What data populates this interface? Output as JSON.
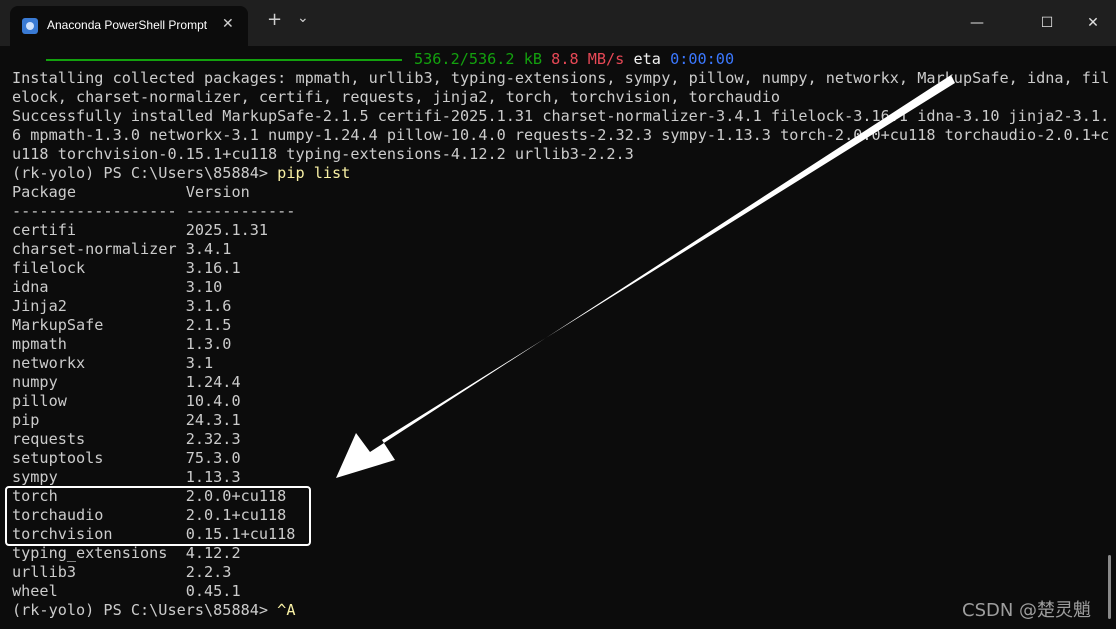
{
  "window": {
    "tab_title": "Anaconda PowerShell Prompt",
    "tab_close": "✕",
    "new_tab": "+",
    "dropdown": "⌄",
    "minimize": "—",
    "maximize": "☐",
    "close": "✕"
  },
  "progress": {
    "size": "536.2/536.2 kB",
    "speed": "8.8 MB/s",
    "eta_label": "eta",
    "eta_value": "0:00:00"
  },
  "output": {
    "installing_1": "Installing collected packages: mpmath, urllib3, typing-extensions, sympy, pillow, numpy, networkx, MarkupSafe, idna, fil",
    "installing_2": "elock, charset-normalizer, certifi, requests, jinja2, torch, torchvision, torchaudio",
    "success_1": "Successfully installed MarkupSafe-2.1.5 certifi-2025.1.31 charset-normalizer-3.4.1 filelock-3.16.1 idna-3.10 jinja2-3.1.",
    "success_2": "6 mpmath-1.3.0 networkx-3.1 numpy-1.24.4 pillow-10.4.0 requests-2.32.3 sympy-1.13.3 torch-2.0.0+cu118 torchaudio-2.0.1+c",
    "success_3": "u118 torchvision-0.15.1+cu118 typing-extensions-4.12.2 urllib3-2.2.3"
  },
  "prompt": "(rk-yolo) PS C:\\Users\\85884> ",
  "command": "pip list",
  "table": {
    "header": "Package            Version",
    "separator": "------------------ ------------",
    "rows": [
      "certifi            2025.1.31",
      "charset-normalizer 3.4.1",
      "filelock           3.16.1",
      "idna               3.10",
      "Jinja2             3.1.6",
      "MarkupSafe         2.1.5",
      "mpmath             1.3.0",
      "networkx           3.1",
      "numpy              1.24.4",
      "pillow             10.4.0",
      "pip                24.3.1",
      "requests           2.32.3",
      "setuptools         75.3.0",
      "sympy              1.13.3",
      "torch              2.0.0+cu118",
      "torchaudio         2.0.1+cu118",
      "torchvision        0.15.1+cu118",
      "typing_extensions  4.12.2",
      "urllib3            2.2.3",
      "wheel              0.45.1"
    ]
  },
  "final_prompt_input": "^A",
  "watermark": "CSDN @楚灵魈",
  "colors": {
    "background": "#0c0c0c",
    "progress_green": "#13a10e",
    "speed_red": "#e74856",
    "eta_blue": "#3b78ff",
    "command_yellow": "#f9f1a5",
    "annotation": "#ffffff"
  }
}
